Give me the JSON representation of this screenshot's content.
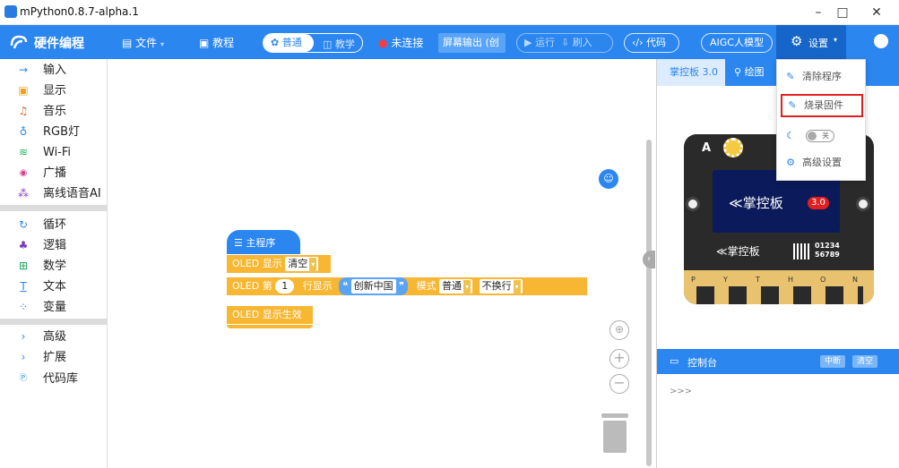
{
  "window": {
    "title": "mPython0.8.7-alpha.1",
    "minimize": "–",
    "maximize": "□",
    "close": "✕"
  },
  "toolbar": {
    "brand": "硬件编程",
    "file": "文件",
    "tutorial": "教程",
    "mode_normal": "普通",
    "mode_teach": "教学",
    "connection": "未连接",
    "screen_output": "屏幕输出 (创",
    "run": "运行",
    "flash": "刷入",
    "code": "代码",
    "aigc": "AIGC人模型",
    "settings": "设置"
  },
  "sidebar": {
    "items": [
      {
        "label": "输入",
        "icon": "→",
        "color": "#2b86f0"
      },
      {
        "label": "显示",
        "icon": "▣",
        "color": "#f0a020"
      },
      {
        "label": "音乐",
        "icon": "♫",
        "color": "#e65a2a"
      },
      {
        "label": "RGB灯",
        "icon": "♁",
        "color": "#2b86f0"
      },
      {
        "label": "Wi-Fi",
        "icon": "≋",
        "color": "#19b35c"
      },
      {
        "label": "广播",
        "icon": "◉",
        "color": "#d63a8a"
      },
      {
        "label": "离线语音AI",
        "icon": "⁂",
        "color": "#9040c0"
      },
      {
        "label": "循环",
        "icon": "↻",
        "color": "#2b86f0"
      },
      {
        "label": "逻辑",
        "icon": "♣",
        "color": "#7a3ac0"
      },
      {
        "label": "数学",
        "icon": "⊞",
        "color": "#19a35c"
      },
      {
        "label": "文本",
        "icon": "T",
        "color": "#2b86f0"
      },
      {
        "label": "变量",
        "icon": "⁘",
        "color": "#2b86f0"
      },
      {
        "label": "高级",
        "icon": "›",
        "color": "#2b86f0"
      },
      {
        "label": "扩展",
        "icon": "›",
        "color": "#2b86f0"
      },
      {
        "label": "代码库",
        "icon": "P",
        "color": "#2b86f0"
      }
    ]
  },
  "blocks": {
    "main": "主程序",
    "oled_show": "OLED 显示",
    "clear": "清空",
    "oled_line": "OLED 第",
    "line_no": "1",
    "line_show": "行显示",
    "text_value": "创新中国",
    "mode_label": "模式",
    "mode_value": "普通",
    "wrap_value": "不换行",
    "oled_effect": "OLED 显示生效"
  },
  "rpanel": {
    "tab_board": "掌控板 3.0",
    "tab_draw": "绘图",
    "board_logo": "掌控板",
    "board_version": "3.0",
    "board_small": "掌控板",
    "board_serial1": "01234",
    "board_serial2": "56789",
    "board_letter": "A",
    "pins": [
      "P",
      "Y",
      "T",
      "H",
      "O",
      "N"
    ],
    "console_title": "控制台",
    "btn_stop": "中断",
    "btn_clear": "清空",
    "prompt": ">>>"
  },
  "menu": {
    "clear_program": "清除程序",
    "burn_firmware": "烧录固件",
    "toggle_label": "关",
    "advanced": "高级设置"
  },
  "colors": {
    "accent": "#2b86f0",
    "block_orange": "#f7b733",
    "block_blue": "#2b86f0",
    "highlight": "#e02020"
  }
}
